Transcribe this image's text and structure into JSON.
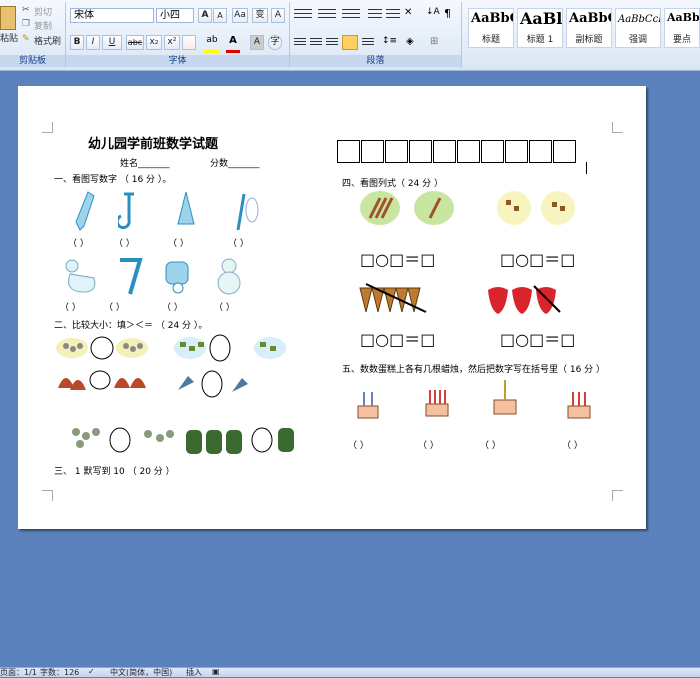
{
  "ribbon": {
    "clipboard": {
      "cut": "剪切",
      "copy": "复制",
      "format_painter": "格式刷",
      "paste": "粘贴",
      "group": "剪贴板"
    },
    "font": {
      "name": "宋体",
      "size": "小四",
      "group": "字体",
      "bold": "B",
      "italic": "I",
      "underline": "U",
      "strike": "abc",
      "subscript": "x₂",
      "superscript": "x²",
      "change_case": "Aa",
      "grow": "A",
      "shrink": "A",
      "phonetic": "变",
      "border": "A"
    },
    "paragraph": {
      "group": "段落"
    },
    "styles": [
      {
        "sample": "AaBbC",
        "name": "标题"
      },
      {
        "sample": "AaBl",
        "name": "标题 1"
      },
      {
        "sample": "AaBbC",
        "name": "副标题"
      },
      {
        "sample": "AaBbCcDı",
        "name": "强调"
      },
      {
        "sample": "AaBbC",
        "name": "要点"
      }
    ]
  },
  "doc": {
    "title": "幼儿园学前班数学试题",
    "name_line": "姓名_______",
    "score_line": "分数_______",
    "q1": "一、看图写数字 （ 16 分 ）。",
    "q2": "二、比较大小：填＞＜＝ （ 24 分 ）。",
    "q3": "三、 1 默写到 10 （ 20 分 ）",
    "q4": "四、看图列式（ 24 分 ）",
    "q5": "五、数数蛋糕上各有几根蜡烛，然后把数字写在括号里（ 16 分 ）",
    "bracket": "（ ）",
    "equation": "□○□＝□"
  },
  "statusbar": {
    "page": "页面：1/1",
    "words": "字数：126",
    "language": "中文(简体，中国)",
    "insert": "插入"
  },
  "colors": {
    "icon_blue": "#3a9fc8",
    "ribbon_label": "#15428b",
    "workspace": "#5b82bd"
  }
}
